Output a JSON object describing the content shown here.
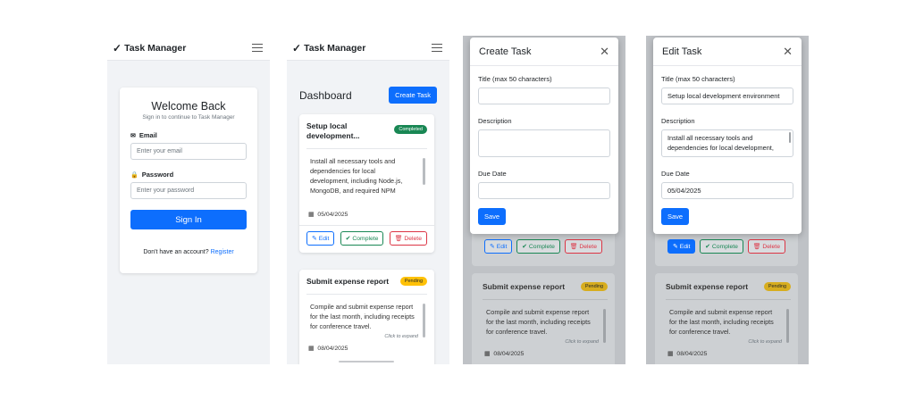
{
  "app": {
    "brand_check": "✓",
    "brand": "Task Manager"
  },
  "login": {
    "title": "Welcome Back",
    "subtitle": "Sign in to continue to Task Manager",
    "email_label": "Email",
    "email_placeholder": "Enter your email",
    "password_label": "Password",
    "password_placeholder": "Enter your password",
    "sign_in": "Sign In",
    "no_account": "Don't have an account?",
    "register": "Register"
  },
  "dashboard": {
    "title": "Dashboard",
    "create_button": "Create Task",
    "tasks": [
      {
        "title": "Setup local development...",
        "status": "Completed",
        "description": "Install all necessary tools and dependencies for local development, including Node.js, MongoDB, and required NPM",
        "due": "05/04/2025"
      },
      {
        "title": "Submit expense report",
        "status": "Pending",
        "description": "Compile and submit expense report for the last month, including receipts for conference travel.",
        "expand": "Click to expand",
        "due": "08/04/2025"
      }
    ],
    "actions": {
      "edit": "Edit",
      "complete": "Complete",
      "delete": "Delete"
    }
  },
  "create_modal": {
    "title": "Create Task",
    "title_label": "Title (max 50 characters)",
    "description_label": "Description",
    "due_label": "Due Date",
    "save": "Save"
  },
  "edit_modal": {
    "title": "Edit Task",
    "title_label": "Title (max 50 characters)",
    "title_value": "Setup local development environment",
    "description_label": "Description",
    "description_value": "Install all necessary tools and dependencies for local development,",
    "due_label": "Due Date",
    "due_value": "05/04/2025",
    "save": "Save"
  },
  "icons": {
    "close": "✕",
    "envelope": "✉",
    "lock": "🔒",
    "calendar": "▦",
    "edit": "✎",
    "check": "✔",
    "trash": "🗑"
  },
  "colors": {
    "primary": "#0d6efd",
    "success": "#198754",
    "danger": "#dc3545",
    "warning": "#ffc107"
  }
}
